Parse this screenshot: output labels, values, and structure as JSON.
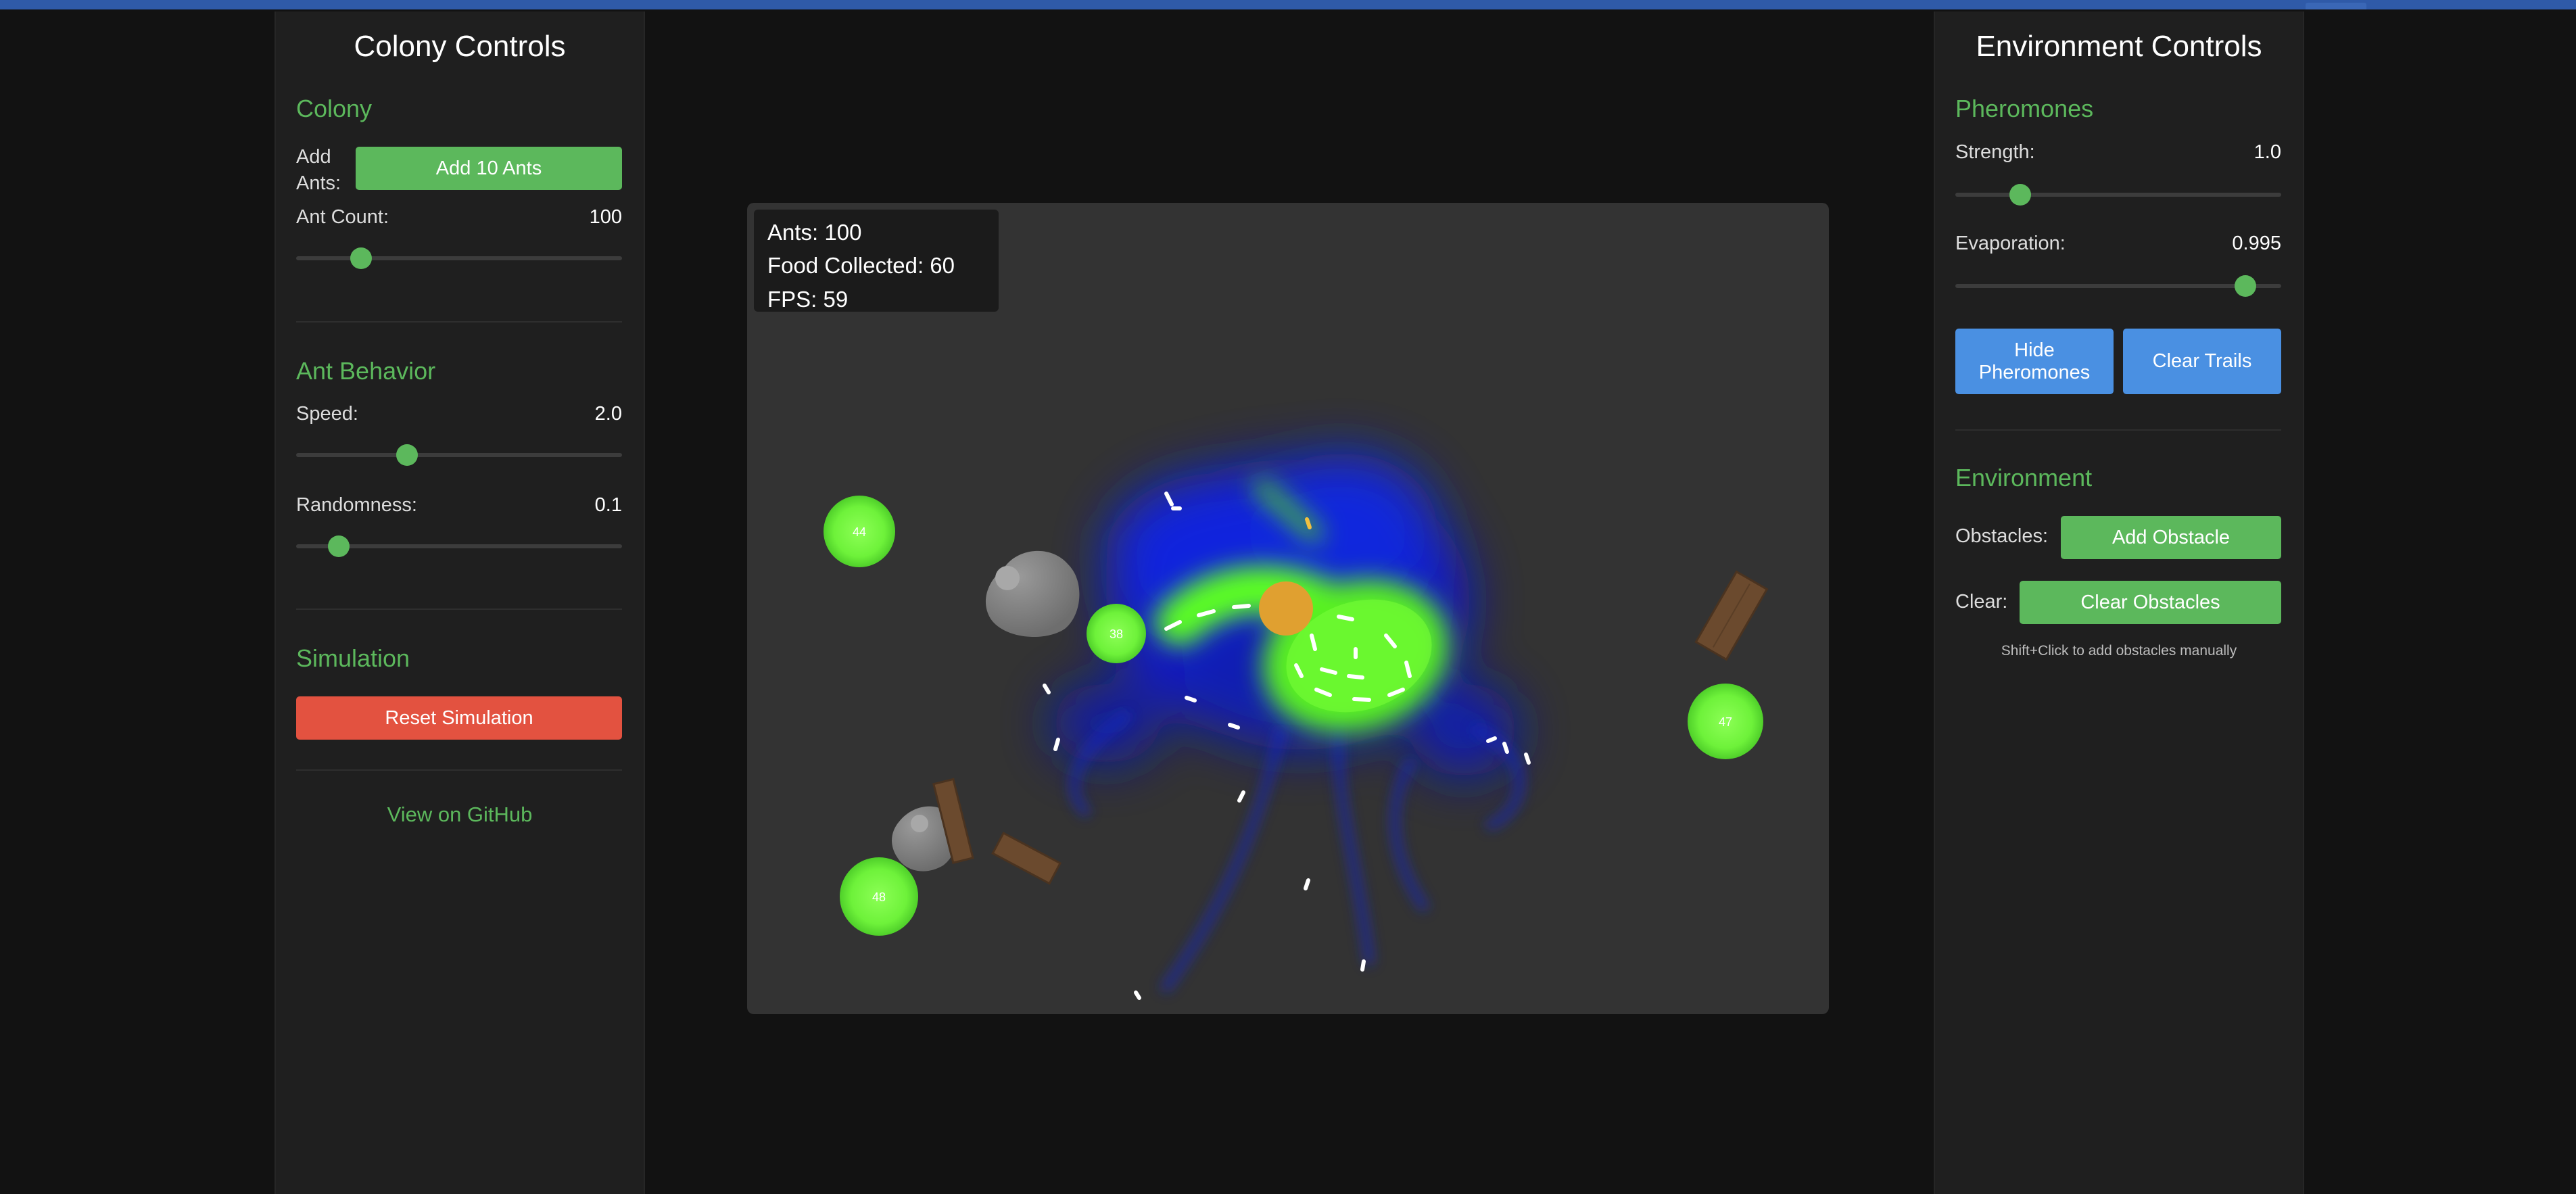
{
  "left_panel": {
    "title": "Colony Controls",
    "colony": {
      "heading": "Colony",
      "add_ants_label": "Add Ants:",
      "add_ants_button": "Add 10 Ants",
      "ant_count_label": "Ant Count:",
      "ant_count_value": "100"
    },
    "behavior": {
      "heading": "Ant Behavior",
      "speed_label": "Speed:",
      "speed_value": "2.0",
      "randomness_label": "Randomness:",
      "randomness_value": "0.1"
    },
    "simulation": {
      "heading": "Simulation",
      "reset_button": "Reset Simulation"
    },
    "github_link": "View on GitHub"
  },
  "right_panel": {
    "title": "Environment Controls",
    "pheromones": {
      "heading": "Pheromones",
      "strength_label": "Strength:",
      "strength_value": "1.0",
      "evaporation_label": "Evaporation:",
      "evaporation_value": "0.995",
      "hide_button": "Hide Pheromones",
      "clear_trails_button": "Clear Trails"
    },
    "environment": {
      "heading": "Environment",
      "obstacles_label": "Obstacles:",
      "add_obstacle_button": "Add Obstacle",
      "clear_label": "Clear:",
      "clear_obstacles_button": "Clear Obstacles",
      "hint": "Shift+Click to add obstacles manually"
    }
  },
  "stats": {
    "ants": "Ants: 100",
    "food_collected": "Food Collected: 60",
    "fps": "FPS: 59"
  },
  "food_sources": [
    "44",
    "38",
    "47",
    "48"
  ],
  "sliders": {
    "ant_count": 0.2,
    "speed": 0.34,
    "randomness": 0.13,
    "strength": 0.2,
    "evaporation": 0.89
  },
  "colors": {
    "accent_green": "#5cb85c",
    "reset_red": "#e35240",
    "action_blue": "#4a90e2",
    "pheromone_blue": "#0a1ee6",
    "food_trail_green": "#66ff22",
    "nest_orange": "#e0a030"
  }
}
